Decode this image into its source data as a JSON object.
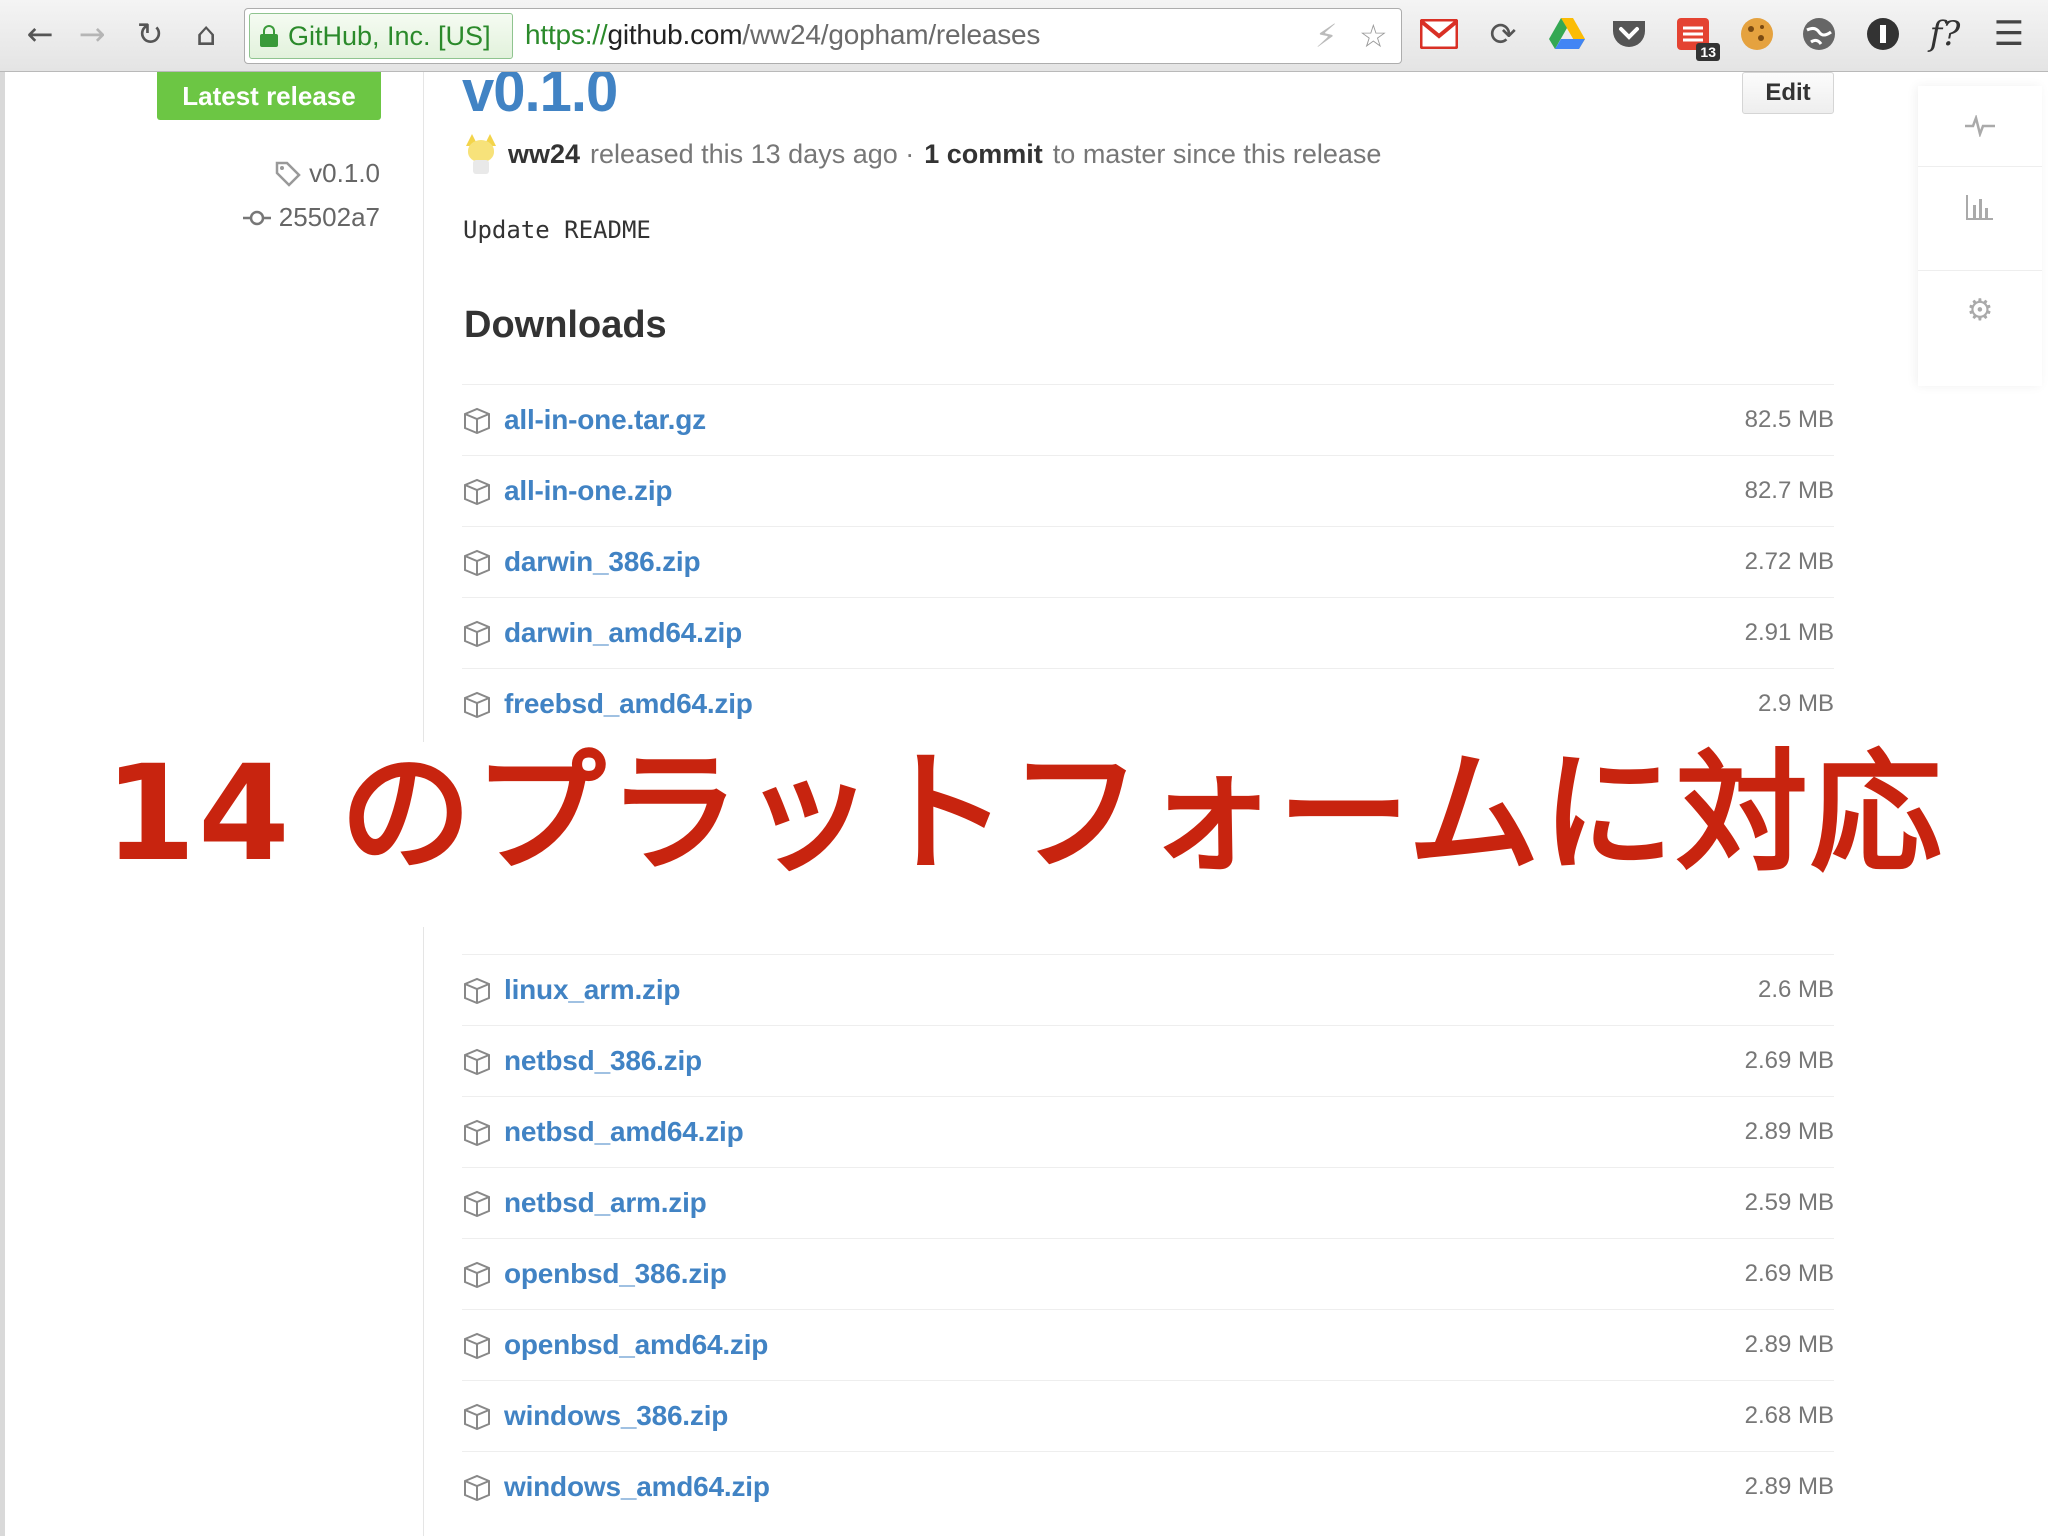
{
  "browser": {
    "ev_label": "GitHub, Inc. [US]",
    "url_scheme": "https://",
    "url_host": "github.com",
    "url_path": "/ww24/gopham/releases",
    "extensions": [
      {
        "name": "gmail-icon"
      },
      {
        "name": "sync-icon"
      },
      {
        "name": "drive-icon"
      },
      {
        "name": "pocket-icon"
      },
      {
        "name": "todoist-icon",
        "badge": "13"
      },
      {
        "name": "cookie-icon"
      },
      {
        "name": "globe-icon"
      },
      {
        "name": "1d-icon"
      },
      {
        "name": "fonts-icon",
        "label": "f?"
      }
    ]
  },
  "sidebar": {
    "latest_label": "Latest release",
    "tag": "v0.1.0",
    "commit": "25502a7"
  },
  "release": {
    "title": "v0.1.0",
    "edit_label": "Edit",
    "author": "ww24",
    "released_text": "released this 13 days ago ·",
    "commits_count": "1 commit",
    "commits_suffix": "to master since this release",
    "note": "Update README",
    "downloads_heading": "Downloads"
  },
  "downloads_top": [
    {
      "name": "all-in-one.tar.gz",
      "size": "82.5 MB"
    },
    {
      "name": "all-in-one.zip",
      "size": "82.7 MB"
    },
    {
      "name": "darwin_386.zip",
      "size": "2.72 MB"
    },
    {
      "name": "darwin_amd64.zip",
      "size": "2.91 MB"
    },
    {
      "name": "freebsd_amd64.zip",
      "size": "2.9 MB"
    }
  ],
  "downloads_bottom": [
    {
      "name": "linux_arm.zip",
      "size": "2.6 MB"
    },
    {
      "name": "netbsd_386.zip",
      "size": "2.69 MB"
    },
    {
      "name": "netbsd_amd64.zip",
      "size": "2.89 MB"
    },
    {
      "name": "netbsd_arm.zip",
      "size": "2.59 MB"
    },
    {
      "name": "openbsd_386.zip",
      "size": "2.69 MB"
    },
    {
      "name": "openbsd_amd64.zip",
      "size": "2.89 MB"
    },
    {
      "name": "windows_386.zip",
      "size": "2.68 MB"
    },
    {
      "name": "windows_amd64.zip",
      "size": "2.89 MB"
    }
  ],
  "caption": "14 のプラットフォームに対応",
  "colors": {
    "link": "#4183c4",
    "latest_green": "#6cc644",
    "caption_red": "#c8240f"
  }
}
